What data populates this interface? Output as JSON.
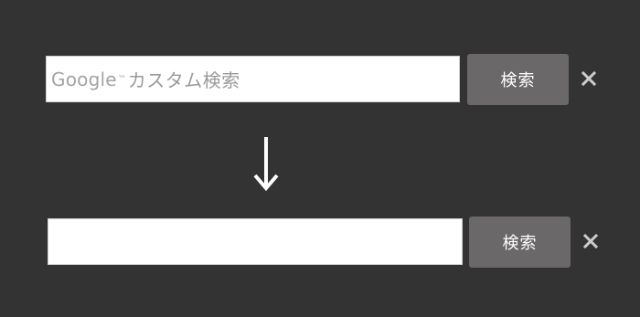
{
  "before": {
    "brand": "Google",
    "trademark": "™",
    "placeholder": "カスタム検索",
    "button_label": "検索",
    "close_symbol": "×"
  },
  "after": {
    "value": "",
    "button_label": "検索",
    "close_symbol": "×"
  },
  "arrow": {
    "icon": "down-arrow-icon"
  },
  "colors": {
    "background": "#333333",
    "button": "#6a6869",
    "field": "#ffffff",
    "placeholder": "#9a9a9a",
    "close": "#cccccc"
  }
}
